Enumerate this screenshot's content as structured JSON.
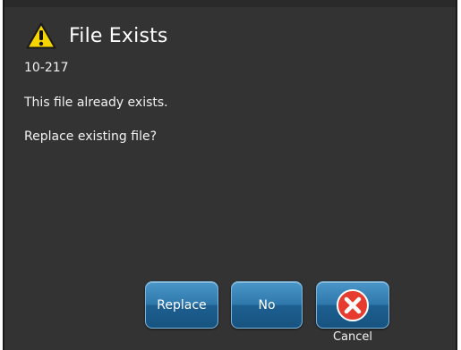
{
  "dialog": {
    "title": "File Exists",
    "code": "10-217",
    "message": "This file already exists.",
    "question": "Replace existing file?",
    "title_icon": "warning-icon",
    "background": "#333333"
  },
  "buttons": {
    "replace_label": "Replace",
    "no_label": "No",
    "cancel_label": "Cancel",
    "cancel_icon": "close-icon",
    "accent": "#2f79ad"
  }
}
